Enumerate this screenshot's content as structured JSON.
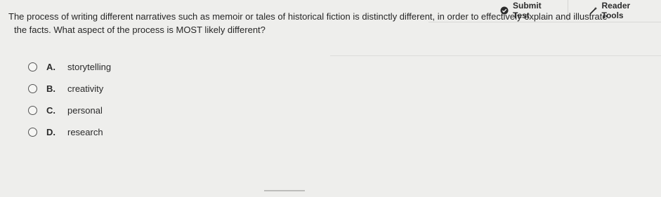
{
  "toolbar": {
    "submit_label": "Submit Test",
    "submit_icon": "check-circle-icon",
    "reader_label": "Reader Tools",
    "reader_icon": "wand-icon"
  },
  "question": {
    "line1": "The process of writing different narratives such as memoir or tales of historical fiction is distinctly different, in order to effectively explain and illustrate",
    "line2": "the facts. What aspect of the process is MOST likely different?"
  },
  "answers": [
    {
      "letter": "A.",
      "text": "storytelling"
    },
    {
      "letter": "B.",
      "text": "creativity"
    },
    {
      "letter": "C.",
      "text": "personal"
    },
    {
      "letter": "D.",
      "text": "research"
    }
  ]
}
